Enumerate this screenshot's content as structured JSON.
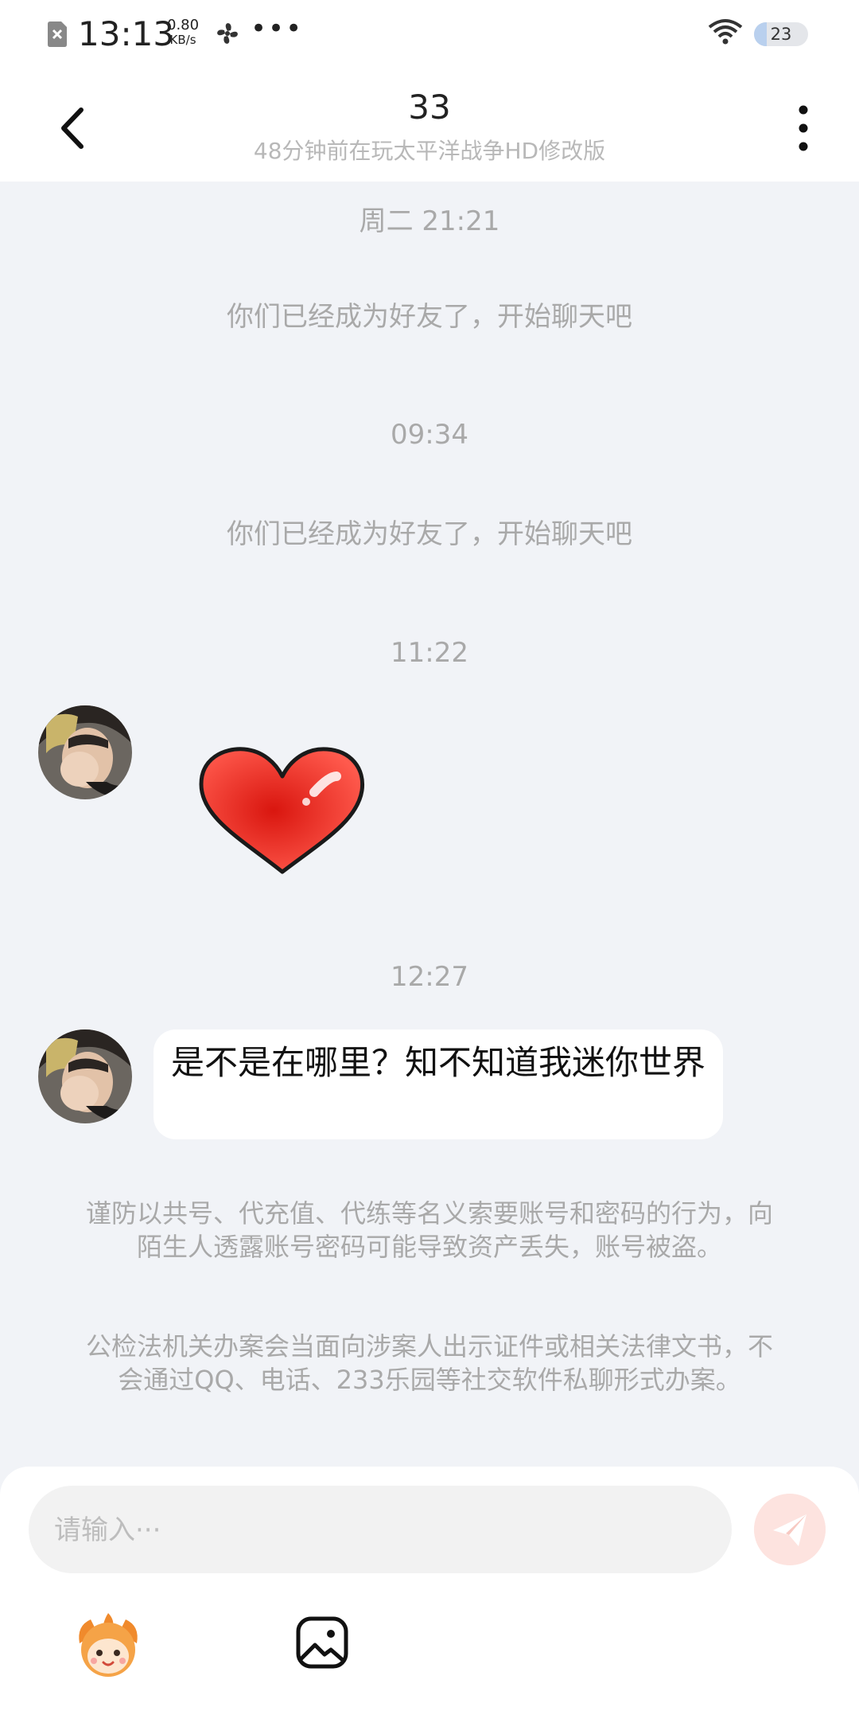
{
  "status_bar": {
    "time": "13:13",
    "speed_value": "0.80",
    "speed_unit": "KB/s",
    "more": "•••",
    "battery": "23",
    "battery_level_percent": 23
  },
  "header": {
    "title": "33",
    "subtitle": "48分钟前在玩太平洋战争HD修改版"
  },
  "messages": {
    "ts1": "周二 21:21",
    "sys1": "你们已经成为好友了，开始聊天吧",
    "ts2": "09:34",
    "sys2": "你们已经成为好友了，开始聊天吧",
    "ts3": "11:22",
    "ts4": "12:27",
    "bubble_text": "是不是在哪里？知不知道我迷你世界"
  },
  "notices": {
    "warning1": "谨防以共号、代充值、代练等名义索要账号和密码的行为，向陌生人透露账号密码可能导致资产丢失，账号被盗。",
    "warning2": "公检法机关办案会当面向涉案人出示证件或相关法律文书，不会通过QQ、电话、233乐园等社交软件私聊形式办案。"
  },
  "input": {
    "placeholder": "请输入···"
  },
  "icons": {
    "back": "chevron-left-icon",
    "more": "vertical-dots-icon",
    "send": "paper-plane-icon",
    "emoji": "mascot-icon",
    "image": "image-icon",
    "sticker": "heart-sticker"
  },
  "colors": {
    "background": "#f1f3f7",
    "send_button": "#fde3df",
    "heart": "#e8322a"
  }
}
